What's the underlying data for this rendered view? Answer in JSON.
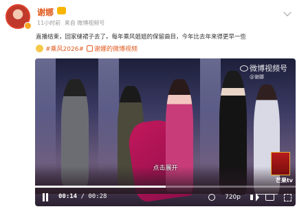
{
  "header": {
    "username": "谢娜",
    "avatar_icon": "avatar",
    "vip_icon": "vip-badge-icon",
    "time": "11小时前",
    "source": "来自 微博视频号",
    "more_icon": "chevron-down-icon"
  },
  "post": {
    "text": "直播结束，回家缝裙子去了。每年乘风姐姐的保留曲目，今年比去年来得更早一些",
    "emoji": "laughing-emoji",
    "hashtag": "#乘风2026#",
    "video_link": "谢娜的微博视频"
  },
  "video": {
    "watermark": "微博视频号",
    "watermark_sub": "@谢娜",
    "platform_logo": "芒果tv",
    "caption": "点击展开",
    "current_time": "00:14",
    "duration": "00:28",
    "progress": 0.5,
    "quality": "720p"
  },
  "colors": {
    "accent": "#e05a1e",
    "text": "#333333",
    "meta": "#999999"
  }
}
